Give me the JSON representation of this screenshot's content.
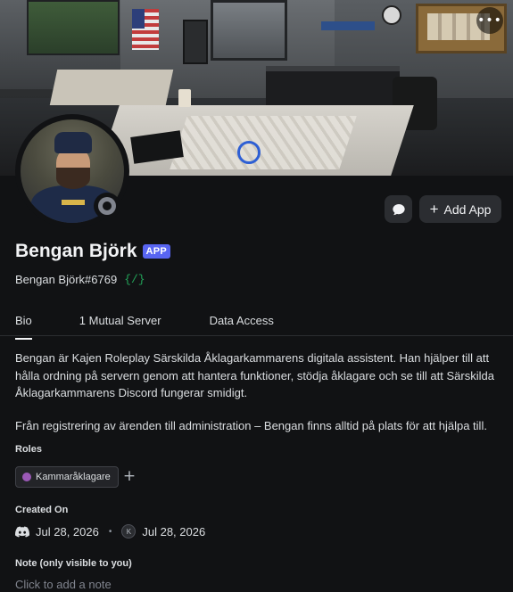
{
  "header": {
    "more_icon": "more-horizontal-icon"
  },
  "profile": {
    "display_name": "Bengan Björk",
    "app_tag": "APP",
    "username": "Bengan Björk#6769",
    "status": "offline",
    "slash_badge": "{/}"
  },
  "actions": {
    "message_icon": "chat-bubble-icon",
    "add_app_label": "Add App",
    "add_app_icon": "+"
  },
  "tabs": [
    {
      "label": "Bio",
      "active": true
    },
    {
      "label": "1 Mutual Server",
      "active": false
    },
    {
      "label": "Data Access",
      "active": false
    }
  ],
  "bio": {
    "paragraph1": "Bengan är Kajen Roleplay Särskilda Åklagarkammarens digitala assistent. Han hjälper till att hålla ordning på servern genom att hantera funktioner, stödja åklagare och se till att Särskilda Åklagarkammarens Discord fungerar smidigt.",
    "paragraph2": "Från registrering av ärenden till administration – Bengan finns alltid på plats för att hjälpa till."
  },
  "roles": {
    "label": "Roles",
    "items": [
      {
        "name": "Kammaråklagare",
        "color": "#9b59b6"
      }
    ],
    "add_icon": "+"
  },
  "created_on": {
    "label": "Created On",
    "discord_date": "Jul 28, 2026",
    "server_date": "Jul 28, 2026",
    "separator": "•",
    "server_icon_text": "K"
  },
  "note": {
    "label": "Note (only visible to you)",
    "placeholder": "Click to add a note"
  },
  "colors": {
    "background": "#111214",
    "accent": "#5865f2",
    "status_offline": "#80848e",
    "slash_green": "#23a55a"
  }
}
